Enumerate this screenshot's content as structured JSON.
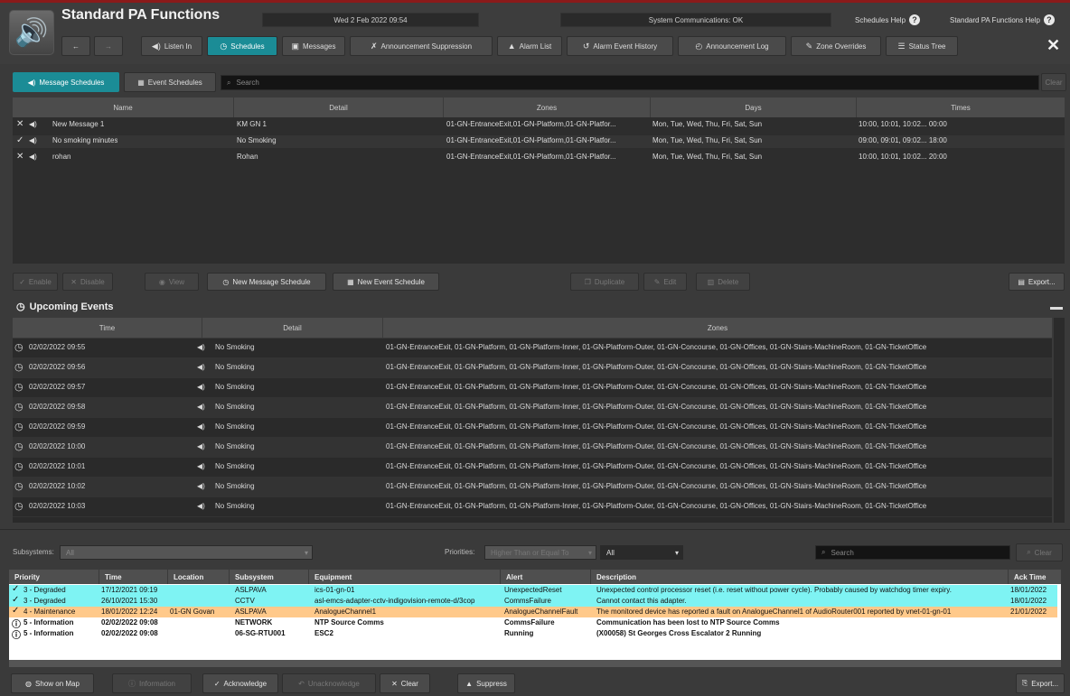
{
  "app": {
    "title": "Standard PA Functions",
    "datetime": "Wed 2 Feb 2022 09:54",
    "comms_status": "System Communications: OK",
    "schedules_help": "Schedules Help",
    "functions_help": "Standard PA Functions Help",
    "close": "✕"
  },
  "nav": {
    "back": "←",
    "forward": "→",
    "items": [
      "Listen In",
      "Schedules",
      "Messages",
      "Announcement Suppression",
      "Alarm List",
      "Alarm Event History",
      "Announcement Log",
      "Zone Overrides",
      "Status Tree"
    ]
  },
  "tabs": {
    "message_schedules": "Message Schedules",
    "event_schedules": "Event Schedules"
  },
  "search": {
    "placeholder": "Search",
    "clear": "Clear"
  },
  "schedules": {
    "columns": [
      "Name",
      "Detail",
      "Zones",
      "Days",
      "Times"
    ],
    "rows": [
      {
        "state": "✕",
        "name": "New Message 1",
        "detail": "KM GN 1",
        "zones": "01-GN-EntranceExit,01-GN-Platform,01-GN-Platfor...",
        "days": "Mon, Tue, Wed, Thu, Fri, Sat, Sun",
        "times": "10:00, 10:01, 10:02... 00:00"
      },
      {
        "state": "✓",
        "name": "No smoking minutes",
        "detail": "No Smoking",
        "zones": "01-GN-EntranceExit,01-GN-Platform,01-GN-Platfor...",
        "days": "Mon, Tue, Wed, Thu, Fri, Sat, Sun",
        "times": "09:00, 09:01, 09:02... 18:00"
      },
      {
        "state": "✕",
        "name": "rohan",
        "detail": "Rohan",
        "zones": "01-GN-EntranceExit,01-GN-Platform,01-GN-Platfor...",
        "days": "Mon, Tue, Wed, Thu, Fri, Sat, Sun",
        "times": "10:00, 10:01, 10:02... 20:00"
      }
    ]
  },
  "actions": {
    "enable": "Enable",
    "disable": "Disable",
    "view": "View",
    "new_message": "New Message Schedule",
    "new_event": "New Event Schedule",
    "duplicate": "Duplicate",
    "edit": "Edit",
    "delete": "Delete",
    "export": "Export..."
  },
  "upcoming": {
    "title": "Upcoming Events",
    "columns": [
      "Time",
      "Detail",
      "Zones"
    ],
    "zones_text": "01-GN-EntranceExit, 01-GN-Platform, 01-GN-Platform-Inner, 01-GN-Platform-Outer, 01-GN-Concourse, 01-GN-Offices, 01-GN-Stairs-MachineRoom, 01-GN-TicketOffice",
    "rows": [
      {
        "time": "02/02/2022 09:55",
        "detail": "No Smoking"
      },
      {
        "time": "02/02/2022 09:56",
        "detail": "No Smoking"
      },
      {
        "time": "02/02/2022 09:57",
        "detail": "No Smoking"
      },
      {
        "time": "02/02/2022 09:58",
        "detail": "No Smoking"
      },
      {
        "time": "02/02/2022 09:59",
        "detail": "No Smoking"
      },
      {
        "time": "02/02/2022 10:00",
        "detail": "No Smoking"
      },
      {
        "time": "02/02/2022 10:01",
        "detail": "No Smoking"
      },
      {
        "time": "02/02/2022 10:02",
        "detail": "No Smoking"
      },
      {
        "time": "02/02/2022 10:03",
        "detail": "No Smoking"
      }
    ]
  },
  "alarm_filters": {
    "subsystems_label": "Subsystems:",
    "subsystems_value": "All",
    "priorities_label": "Priorities:",
    "priorities_value": "Higher Than or Equal To",
    "priorities_level": "All",
    "search_placeholder": "Search",
    "clear": "Clear"
  },
  "alarms": {
    "columns": [
      "Priority",
      "Time",
      "Location",
      "Subsystem",
      "Equipment",
      "Alert",
      "Description",
      "Ack Time"
    ],
    "rows": [
      {
        "icon": "✓",
        "priority": "3 - Degraded",
        "time": "17/12/2021 09:19",
        "location": "",
        "subsystem": "ASLPAVA",
        "equipment": "ics-01-gn-01",
        "alert": "UnexpectedReset",
        "description": "Unexpected control processor reset (i.e. reset without power cycle). Probably caused by watchdog timer expiry.",
        "ack": "18/01/2022",
        "bg": "#7ef3f3"
      },
      {
        "icon": "✓",
        "priority": "3 - Degraded",
        "time": "26/10/2021 15:30",
        "location": "",
        "subsystem": "CCTV",
        "equipment": "asl-emcs-adapter-cctv-indigovision-remote-d/3cop",
        "alert": "CommsFailure",
        "description": "Cannot contact this adapter.",
        "ack": "18/01/2022",
        "bg": "#7ef3f3"
      },
      {
        "icon": "✓",
        "priority": "4 - Maintenance",
        "time": "18/01/2022 12:24",
        "location": "01-GN Govan",
        "subsystem": "ASLPAVA",
        "equipment": "AnalogueChannel1",
        "alert": "AnalogueChannelFault",
        "description": "The monitored device has reported a fault on AnalogueChannel1 of AudioRouter001 reported by vnet-01-gn-01",
        "ack": "21/01/2022",
        "bg": "#ffc98a"
      },
      {
        "icon": "ⓘ",
        "priority": "5 - Information",
        "time": "02/02/2022 09:08",
        "location": "",
        "subsystem": "NETWORK",
        "equipment": "NTP Source Comms",
        "alert": "CommsFailure",
        "description": "Communication has been lost to NTP Source Comms",
        "ack": "",
        "bg": "#ffffff"
      },
      {
        "icon": "ⓘ",
        "priority": "5 - Information",
        "time": "02/02/2022 09:08",
        "location": "",
        "subsystem": "06-SG-RTU001",
        "equipment": "ESC2",
        "alert": "Running",
        "description": "(X00058) St Georges Cross Escalator 2 Running",
        "ack": "",
        "bg": "#ffffff"
      }
    ]
  },
  "bottom": {
    "show_on_map": "Show on Map",
    "information": "Information",
    "acknowledge": "Acknowledge",
    "unacknowledge": "Unacknowledge",
    "clear": "Clear",
    "suppress": "Suppress",
    "export": "Export..."
  },
  "colors": {
    "accent": "#1b8c96",
    "degraded": "#7ef3f3",
    "maintenance": "#ffc98a"
  }
}
